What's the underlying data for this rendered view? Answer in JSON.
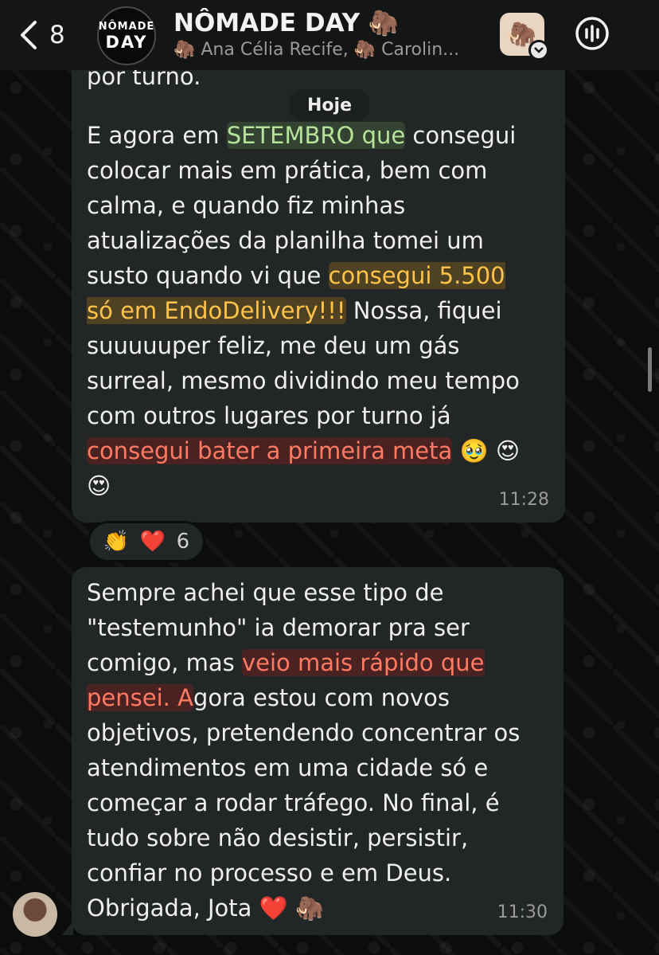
{
  "header": {
    "back_count": "8",
    "group_logo_line1": "NÔMADE",
    "group_logo_line2": "DAY",
    "title": "NÔMADE DAY 🦣",
    "subtitle": "🦣 Ana  Célia Recife, 🦣 Carolin..."
  },
  "chat": {
    "top_cut_line": "por turno.",
    "date_label": "Hoje",
    "message1": {
      "p1": "E agora em ",
      "h1": "SETEMBRO que",
      "p2": " consegui\ncolocar mais em prática, bem com\ncalma, e quando fiz minhas\natualizações da planilha tomei um\nsusto quando vi que ",
      "h2": "consegui 5.500\nsó em EndoDelivery!!!",
      "p3": " Nossa, fiquei\nsuuuuuper feliz, me deu um gás\nsurreal, mesmo dividindo meu tempo\ncom outros lugares por turno já\n",
      "h3": "consegui bater a primeira meta",
      "p4": " 🥹 😍\n😍",
      "time": "11:28"
    },
    "reactions": {
      "emoji1": "👏",
      "emoji2": "❤️",
      "count": "6"
    },
    "message2": {
      "p1": "Sempre achei que esse tipo de\n\"testemunho\" ia demorar pra ser\ncomigo, mas ",
      "h1": "veio mais rápido que\npensei. A",
      "p2": "gora estou com novos\nobjetivos, pretendendo concentrar os\natendimentos em uma cidade só e\ncomeçar a rodar tráfego. No final, é\ntudo sobre não desistir, persistir,\nconfiar no processo e em Deus.\nObrigada, Jota ❤️ 🦣",
      "time": "11:30"
    }
  },
  "colors": {
    "bubble": "#232626",
    "highlight_green": "#b6e39a",
    "highlight_yellow": "#ffc24a",
    "highlight_red": "#ff7a62"
  }
}
